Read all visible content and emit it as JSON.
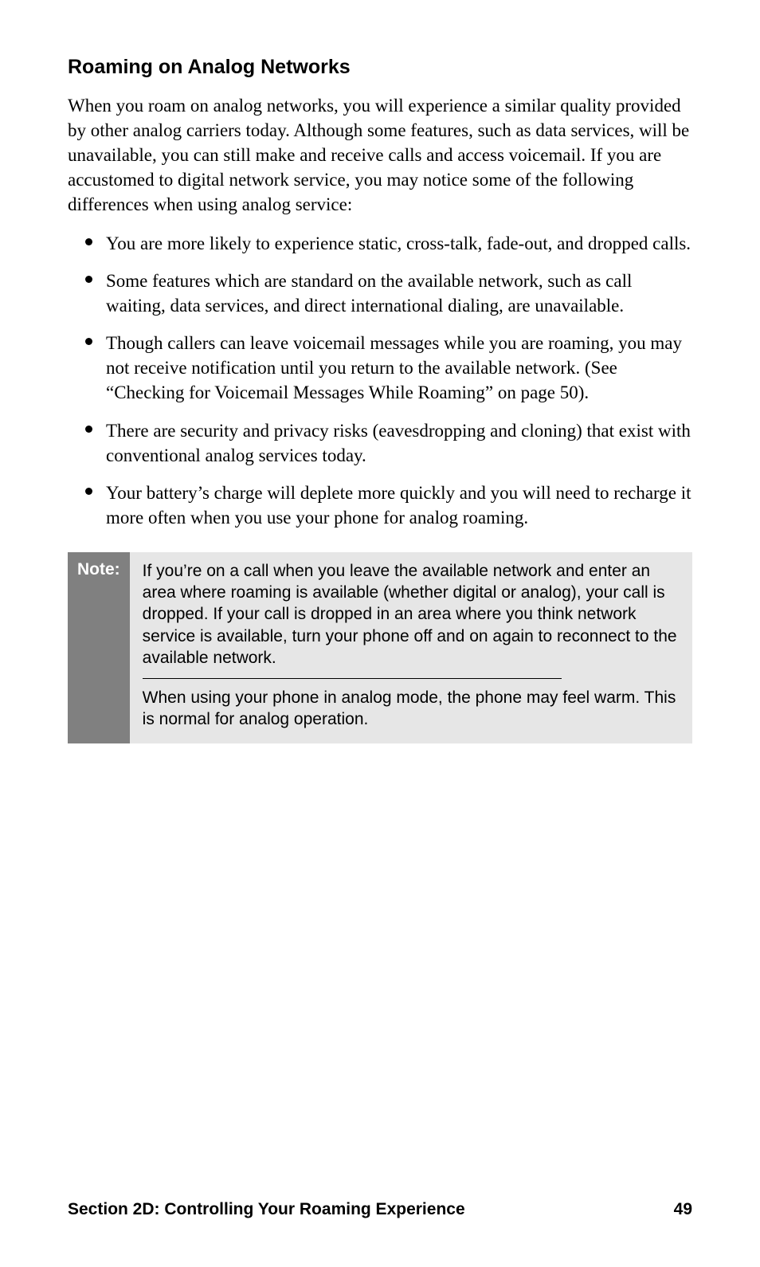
{
  "heading": "Roaming on Analog Networks",
  "intro": "When you roam on analog networks, you will experience a similar quality provided by other analog carriers today. Although some features, such as data services, will be unavailable, you can still make and receive calls and access voicemail. If you are accustomed to digital network service, you may notice some of the following differences when using analog service:",
  "bullets": [
    "You are more likely to experience static, cross-talk, fade-out, and dropped calls.",
    "Some features which are standard on the available network, such as call waiting, data services, and direct international dialing, are unavailable.",
    "Though callers can leave voicemail messages while you are roaming, you may not receive notification until you return to the available network. (See “Checking for Voicemail Messages While Roaming” on page 50).",
    "There are security and privacy risks (eavesdropping and cloning) that exist with conventional analog services today.",
    "Your battery’s charge will deplete more quickly and you will need to recharge it more often when you use your phone for analog roaming."
  ],
  "note": {
    "label": "Note:",
    "p1": "If you’re on a call when you leave the available network and enter an area where roaming is available (whether digital or analog), your call is dropped. If your call is dropped in an area where you think network service is available, turn your phone off and on again to reconnect to the available network.",
    "p2": "When using your phone in analog mode, the phone may feel warm. This is normal for analog operation."
  },
  "footer": {
    "section": "Section 2D: Controlling Your Roaming Experience",
    "page": "49"
  }
}
